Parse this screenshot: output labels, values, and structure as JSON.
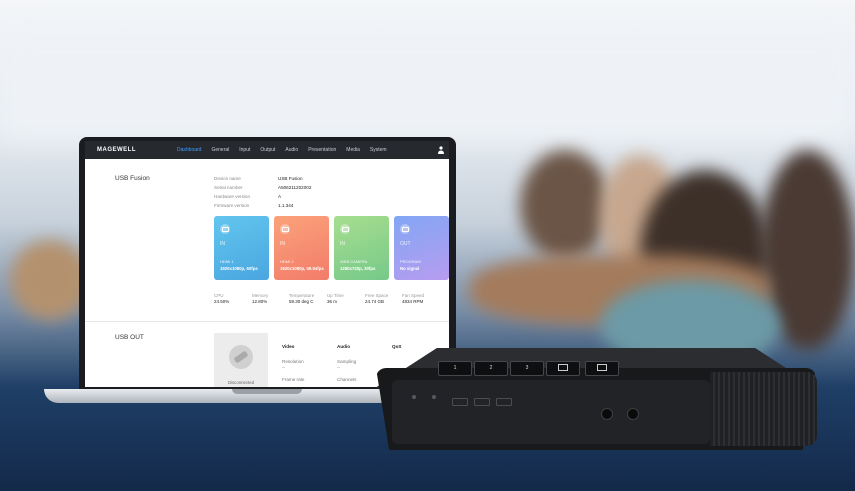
{
  "app": {
    "brand": "MAGEWELL",
    "nav": [
      "Dashboard",
      "General",
      "Input",
      "Output",
      "Audio",
      "Presentation",
      "Media",
      "System"
    ],
    "active_nav": "Dashboard"
  },
  "device_section": {
    "title": "USB Fusion",
    "info": [
      {
        "label": "Device name",
        "value": "USB Fusion"
      },
      {
        "label": "Serial number",
        "value": "A506211202002"
      },
      {
        "label": "Hardware version",
        "value": "A"
      },
      {
        "label": "Firmware version",
        "value": "1.1.344"
      }
    ]
  },
  "cards": [
    {
      "dir": "IN",
      "name": "HDMI 1",
      "res": "1920x1080p, 60fps",
      "color": "#5bb8e8"
    },
    {
      "dir": "IN",
      "name": "HDMI 2",
      "res": "1920x1080p, 59.94fps",
      "color": "#f58c6c"
    },
    {
      "dir": "IN",
      "name": "WEB CAMERA",
      "res": "1280x720p, 30fps",
      "color": "#8fd48a"
    },
    {
      "dir": "OUT",
      "name": "PROGRAM",
      "res": "No signal",
      "color": "#7f9cf0"
    }
  ],
  "stats": [
    {
      "label": "CPU",
      "value": "24.50%"
    },
    {
      "label": "Memory",
      "value": "12.80%"
    },
    {
      "label": "Temperature",
      "value": "59.30 deg C"
    },
    {
      "label": "Up Time",
      "value": "36 m"
    },
    {
      "label": "Free Space",
      "value": "24.74 GB"
    },
    {
      "label": "Fan Speed",
      "value": "4834 RPM"
    }
  ],
  "usb_out": {
    "title": "USB OUT",
    "preview_status": "Disconnected",
    "headings": [
      "Video",
      "Audio",
      "QoS"
    ],
    "fields": [
      {
        "label": "Resolution",
        "value": "--"
      },
      {
        "label": "Sampling",
        "value": "--"
      },
      {
        "label": "Frame rate",
        "value": ""
      },
      {
        "label": "Channels",
        "value": ""
      }
    ]
  },
  "hardware": {
    "buttons": [
      "1",
      "2",
      "3",
      "",
      ""
    ]
  }
}
